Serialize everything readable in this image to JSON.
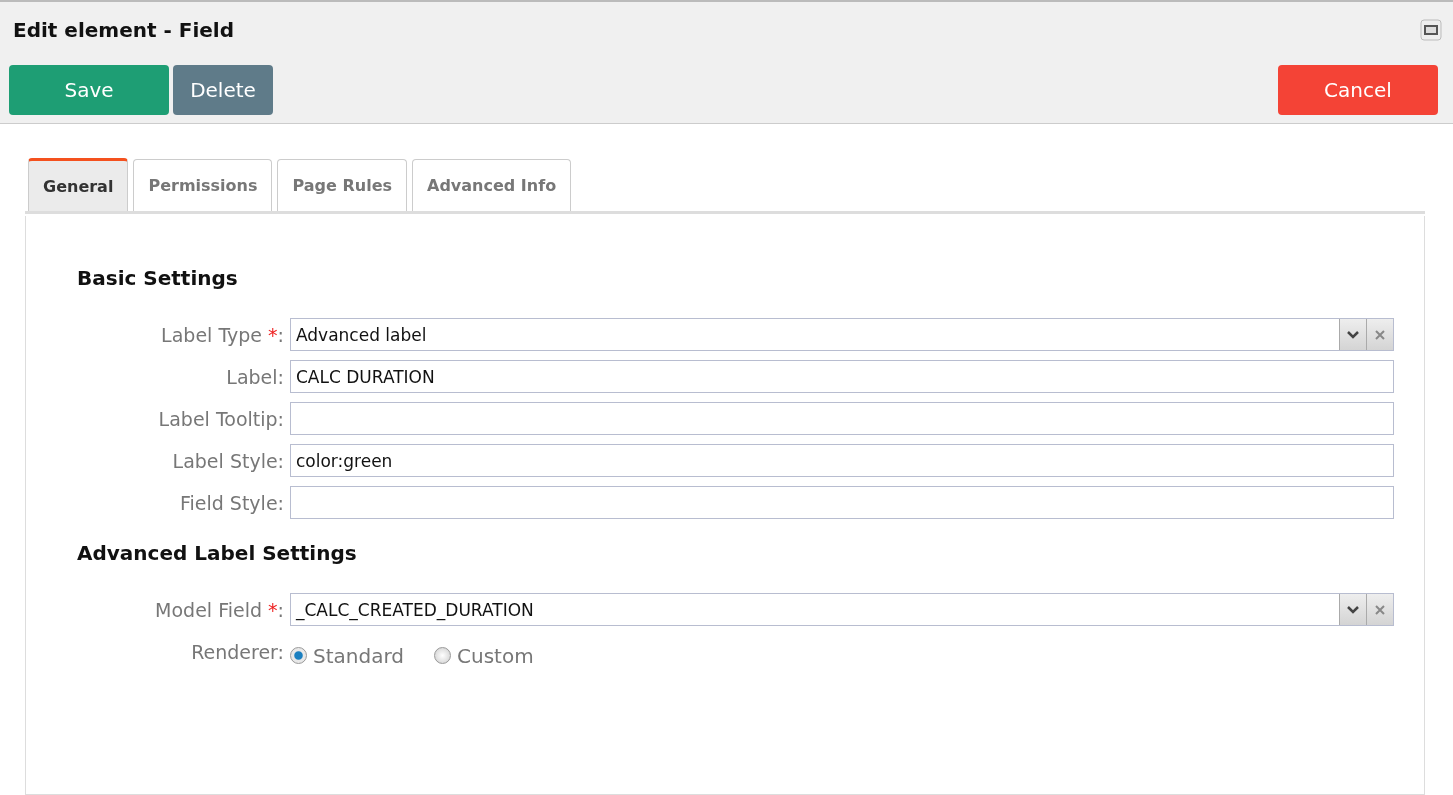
{
  "window": {
    "title": "Edit element - Field"
  },
  "buttons": [
    {
      "label": "Save",
      "kind": "save"
    },
    {
      "label": "Delete",
      "kind": "delete"
    },
    {
      "label": "Cancel",
      "kind": "cancel"
    }
  ],
  "tabs": [
    {
      "label": "General",
      "selected": true
    },
    {
      "label": "Permissions",
      "selected": false
    },
    {
      "label": "Page Rules",
      "selected": false
    },
    {
      "label": "Advanced Info",
      "selected": false
    }
  ],
  "sections": [
    {
      "title": "Basic Settings",
      "rows": [
        {
          "kind": "select",
          "label": "Label Type",
          "mark": "*",
          "colon": ":",
          "value": "Advanced label"
        },
        {
          "kind": "text",
          "label": "Label:",
          "value": "CALC DURATION"
        },
        {
          "kind": "text",
          "label": "Label Tooltip:"
        },
        {
          "kind": "text",
          "label": "Label Style:",
          "value": "color:green"
        },
        {
          "kind": "text",
          "label": "Field Style:"
        }
      ]
    },
    {
      "title": "Advanced Label Settings",
      "rows": [
        {
          "kind": "select",
          "label": "Model Field",
          "mark": "*",
          "colon": ":",
          "value": "_CALC_CREATED_DURATION"
        },
        {
          "kind": "radio",
          "label": "Renderer:",
          "options": [
            {
              "label": "Standard",
              "selected": true
            },
            {
              "label": "Custom",
              "selected": false
            }
          ]
        }
      ]
    }
  ]
}
